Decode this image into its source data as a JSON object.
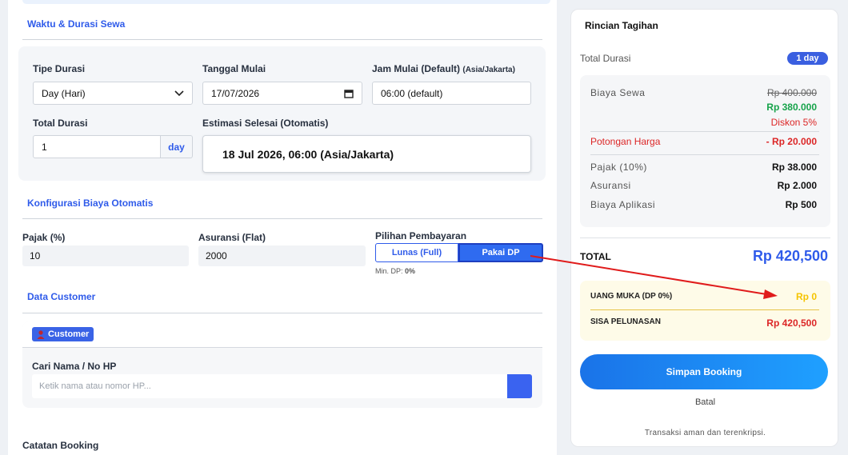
{
  "booking_form": {
    "waktu": {
      "title": "Waktu & Durasi Sewa",
      "tipe_durasi_label": "Tipe Durasi",
      "tipe_durasi_value": "Day (Hari)",
      "tanggal_mulai_label": "Tanggal Mulai",
      "tanggal_mulai_value": "17/07/2026",
      "jam_mulai_label": "Jam Mulai (Default)",
      "jam_mulai_tz": "(Asia/Jakarta)",
      "jam_mulai_value": "06:00 (default)",
      "total_durasi_label": "Total Durasi",
      "total_durasi_value": "1",
      "total_durasi_unit": "day",
      "estimasi_label": "Estimasi Selesai (Otomatis)",
      "estimasi_value": "18 Jul 2026, 06:00 (Asia/Jakarta)"
    },
    "biaya": {
      "title": "Konfigurasi Biaya Otomatis",
      "pajak_label": "Pajak (%)",
      "pajak_value": "10",
      "asuransi_label": "Asuransi (Flat)",
      "asuransi_value": "2000",
      "pembayaran_label": "Pilihan Pembayaran",
      "option_full": "Lunas (Full)",
      "option_dp": "Pakai DP",
      "selected_option": "Pakai DP",
      "min_dp_prefix": "Min. DP: ",
      "min_dp_value": "0%"
    },
    "customer": {
      "title": "Data Customer",
      "badge": "Customer",
      "search_label": "Cari Nama / No HP",
      "search_placeholder": "Ketik nama atau nomor HP..."
    },
    "catatan_label": "Catatan Booking"
  },
  "summary": {
    "title": "Rincian Tagihan",
    "total_durasi_label": "Total Durasi",
    "total_durasi_badge": "1 day",
    "biaya_sewa_label": "Biaya Sewa",
    "biaya_sewa_original": "Rp 400.000",
    "biaya_sewa_discounted": "Rp 380.000",
    "diskon_text": "Diskon 5%",
    "potongan_label": "Potongan Harga",
    "potongan_value": "- Rp 20.000",
    "pajak_label": "Pajak (10%)",
    "pajak_value": "Rp 38.000",
    "asuransi_label": "Asuransi",
    "asuransi_value": "Rp 2.000",
    "aplikasi_label": "Biaya Aplikasi",
    "aplikasi_value": "Rp 500",
    "total_label": "TOTAL",
    "total_value": "Rp 420,500",
    "uang_muka_label": "UANG MUKA (DP 0%)",
    "uang_muka_value": "Rp 0",
    "sisa_label": "SISA PELUNASAN",
    "sisa_value": "Rp 420,500",
    "save_button": "Simpan Booking",
    "cancel_link": "Batal",
    "secure_text": "Transaksi aman dan terenkripsi."
  },
  "colors": {
    "accent_blue": "#2f5bea",
    "green": "#16a34a",
    "red": "#dc2626",
    "yellow": "#f5c400",
    "annotation_arrow": "#e01b1b"
  },
  "icons": {
    "dropdown": "chevron-down-icon",
    "calendar": "calendar-icon",
    "user": "user-icon",
    "arrow": "annotation-arrow"
  }
}
